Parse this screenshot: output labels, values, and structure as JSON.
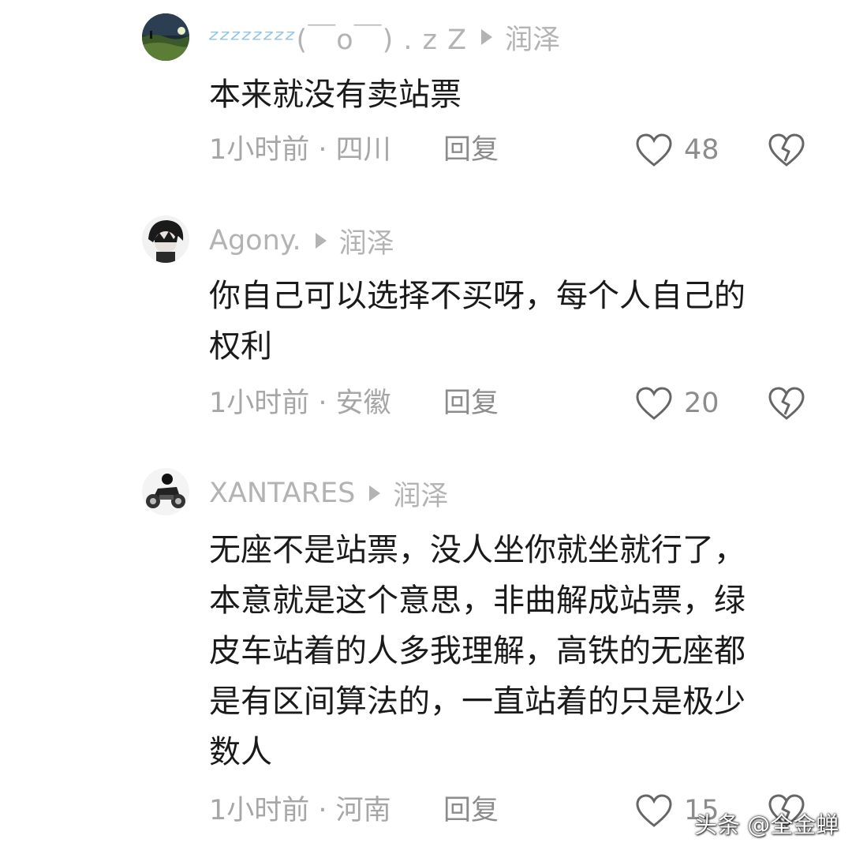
{
  "comments": [
    {
      "username": "ᶻᶻᶻᶻᶻᶻᶻᶻ",
      "username_tail": "(￣o￣) . z Z",
      "reply_to": "润泽",
      "lines": [
        "本来就没有卖站票"
      ],
      "time_location": "1小时前 · 四川",
      "reply_label": "回复",
      "likes": "48",
      "avatar": "night-landscape-avatar"
    },
    {
      "username": "Agony.",
      "reply_to": "润泽",
      "lines": [
        "你自己可以选择不买呀，每个人自己的",
        "权利"
      ],
      "time_location": "1小时前 · 安徽",
      "reply_label": "回复",
      "likes": "20",
      "avatar": "anime-character-avatar"
    },
    {
      "username": "XANTARES",
      "reply_to": "润泽",
      "lines": [
        "无座不是站票，没人坐你就坐就行了，",
        "本意就是这个意思，非曲解成站票，绿",
        "皮车站着的人多我理解，高铁的无座都",
        "是有区间算法的，一直站着的只是极少",
        "数人"
      ],
      "time_location": "1小时前 · 河南",
      "reply_label": "回复",
      "likes": "15",
      "avatar": "motorcycle-rider-avatar"
    }
  ],
  "watermark": "头条 @全金蝉",
  "colors": {
    "meta_text": "#a6a6a6",
    "username_gray": "#b3b3b3",
    "zzz_blue": "#93c4e8",
    "icon_stroke": "#666666"
  }
}
